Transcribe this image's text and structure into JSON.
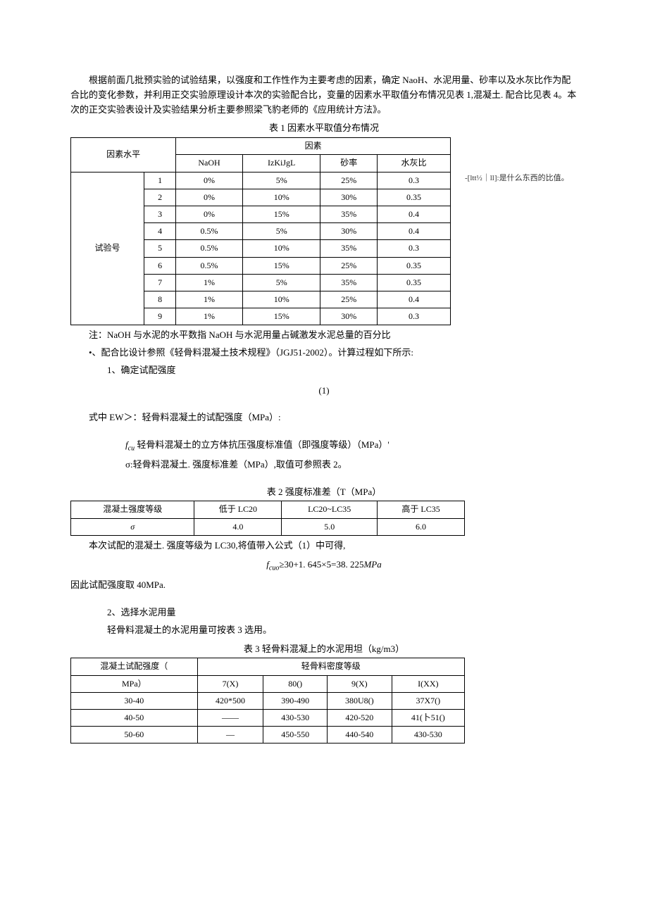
{
  "intro": "根据前面几批预实验的试验结果，以强度和工作性作为主要考虑的因素，确定 NaoH、水泥用量、砂率以及水灰比作为配合比的变化参数，并利用正交实验原理设计本次的实验配合比，变量的因素水平取值分布情况见表 1,混凝土. 配合比见表 4。本次的正交实验表设计及实验结果分析主要参照梁飞豹老师的《应用统计方法》。",
  "table1": {
    "title": "表 1 因素水平取值分布情况",
    "corner": "因素水平",
    "header_factor": "因素",
    "cols": [
      "NaOH",
      "IzKiJgL",
      "砂率",
      "水灰比"
    ],
    "row_header": "试验号",
    "rows": [
      [
        "1",
        "0%",
        "5%",
        "25%",
        "0.3"
      ],
      [
        "2",
        "0%",
        "10%",
        "30%",
        "0.35"
      ],
      [
        "3",
        "0%",
        "15%",
        "35%",
        "0.4"
      ],
      [
        "4",
        "0.5%",
        "5%",
        "30%",
        "0.4"
      ],
      [
        "5",
        "0.5%",
        "10%",
        "35%",
        "0.3"
      ],
      [
        "6",
        "0.5%",
        "15%",
        "25%",
        "0.35"
      ],
      [
        "7",
        "1%",
        "5%",
        "35%",
        "0.35"
      ],
      [
        "8",
        "1%",
        "10%",
        "25%",
        "0.4"
      ],
      [
        "9",
        "1%",
        "15%",
        "30%",
        "0.3"
      ]
    ],
    "note": "注：NaOH 与水泥的水平数指 NaOH 与水泥用量占碱激发水泥总量的百分比"
  },
  "comment": "-[ltt½｜ll]:是什么东西的比值。",
  "bullet1": "•、配合比设计参照《轻骨料混凝土技术规程》（JGJ51-2002）。计算过程如下所示:",
  "step1": "1、确定试配强度",
  "formula1_num": "(1)",
  "ew_line": "式中 EW＞：轻骨料混凝土的试配强度（MPa）:",
  "fcu_line_prefix": "f",
  "fcu_line_sub": "cu",
  "fcu_line_rest": " 轻骨料混凝土的立方体抗压强度标准值（即强度等级）（MPa）'",
  "sigma_line": "σ:轻骨料混凝土. 强度标准差（MPa）,取值可参照表 2。",
  "table2": {
    "title": "表 2 强度标准差（T（MPa）",
    "row1": [
      "混凝土强度等级",
      "低于 LC20",
      "LC20~LC35",
      "高于 LC35"
    ],
    "row2_label": "σ",
    "row2": [
      "4.0",
      "5.0",
      "6.0"
    ]
  },
  "after_t2": "本次试配的混凝土. 强度等级为 LC30,将值带入公式（1）中可得,",
  "formula2_prefix": "f",
  "formula2_sub": "cuo",
  "formula2_rest": "≥30+1. 645×5=38. 225",
  "formula2_unit": "MPa",
  "conclusion1": "因此试配强度取 40MPa.",
  "step2": "2、选择水泥用量",
  "step2_line": "轻骨料混凝土的水泥用量可按表 3 选用。",
  "table3": {
    "title": "表 3 轻骨料混凝上的水泥用坦（kg/m3）",
    "col1_header_l1": "混凝土试配强度（",
    "col1_header_l2": "MPa）",
    "merged_header": "轻骨料密度等级",
    "sub_cols": [
      "7(X)",
      "80()",
      "9(X)",
      "I(XX)"
    ],
    "rows": [
      [
        "30-40",
        "420*500",
        "390-490",
        "380U8()",
        "37X7()"
      ],
      [
        "40-50",
        "——",
        "430-530",
        "420-520",
        "41(卜51()"
      ],
      [
        "50-60",
        "—",
        "450-550",
        "440-540",
        "430-530"
      ]
    ]
  }
}
